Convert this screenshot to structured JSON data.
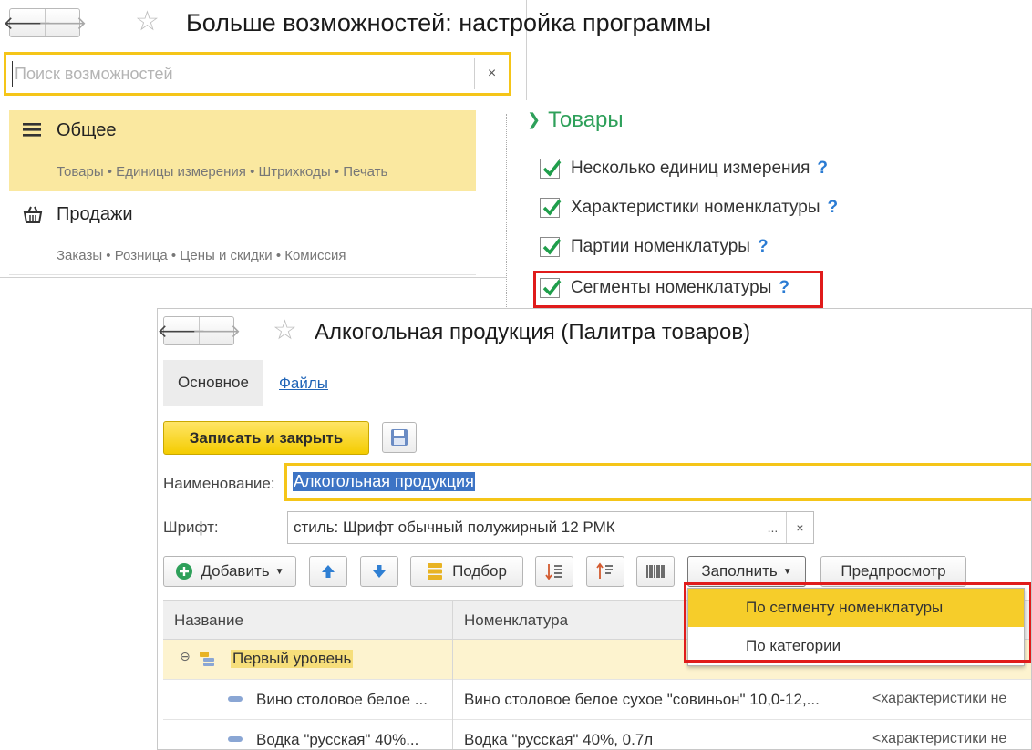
{
  "window1": {
    "title": "Больше возможностей: настройка программы",
    "search_placeholder": "Поиск возможностей",
    "clear_icon": "×",
    "sections": [
      {
        "title": "Общее",
        "subtitle": "Товары • Единицы измерения • Штрихкоды • Печать",
        "icon": "list-icon"
      },
      {
        "title": "Продажи",
        "subtitle": "Заказы • Розница • Цены и скидки • Комиссия",
        "icon": "basket-icon"
      }
    ],
    "group": {
      "title": "Товары",
      "options": [
        {
          "label": "Несколько единиц измерения",
          "checked": true
        },
        {
          "label": "Характеристики номенклатуры",
          "checked": true
        },
        {
          "label": "Партии номенклатуры",
          "checked": true
        },
        {
          "label": "Сегменты номенклатуры",
          "checked": true
        }
      ],
      "help": "?"
    }
  },
  "window2": {
    "title": "Алкогольная продукция (Палитра товаров)",
    "tabs": [
      "Основное",
      "Файлы"
    ],
    "save_close": "Записать и закрыть",
    "name_label": "Наименование:",
    "name_value": "Алкогольная продукция",
    "font_label": "Шрифт:",
    "font_value": "стиль: Шрифт обычный полужирный 12 РМК",
    "font_select": "...",
    "font_clear": "×",
    "toolbar": {
      "add": "Добавить",
      "pick": "Подбор",
      "fill": "Заполнить",
      "preview": "Предпросмотр"
    },
    "columns": [
      "Название",
      "Номенклатура"
    ],
    "rows": [
      {
        "name": "Первый уровень",
        "item": "",
        "extra": ""
      },
      {
        "name": "Вино столовое белое ...",
        "item": "Вино столовое белое сухое \"совиньон\" 10,0-12,...",
        "extra": "<характеристики не"
      },
      {
        "name": "Водка \"русская\" 40%...",
        "item": "Водка \"русская\" 40%, 0.7л",
        "extra": "<характеристики не"
      }
    ],
    "fill_menu": [
      "По сегменту номенклатуры",
      "По категории"
    ]
  },
  "colors": {
    "accent_yellow": "#f5c518",
    "highlight_red": "#e01b1b",
    "group_green": "#2ea05a",
    "link_blue": "#1f64b7"
  }
}
